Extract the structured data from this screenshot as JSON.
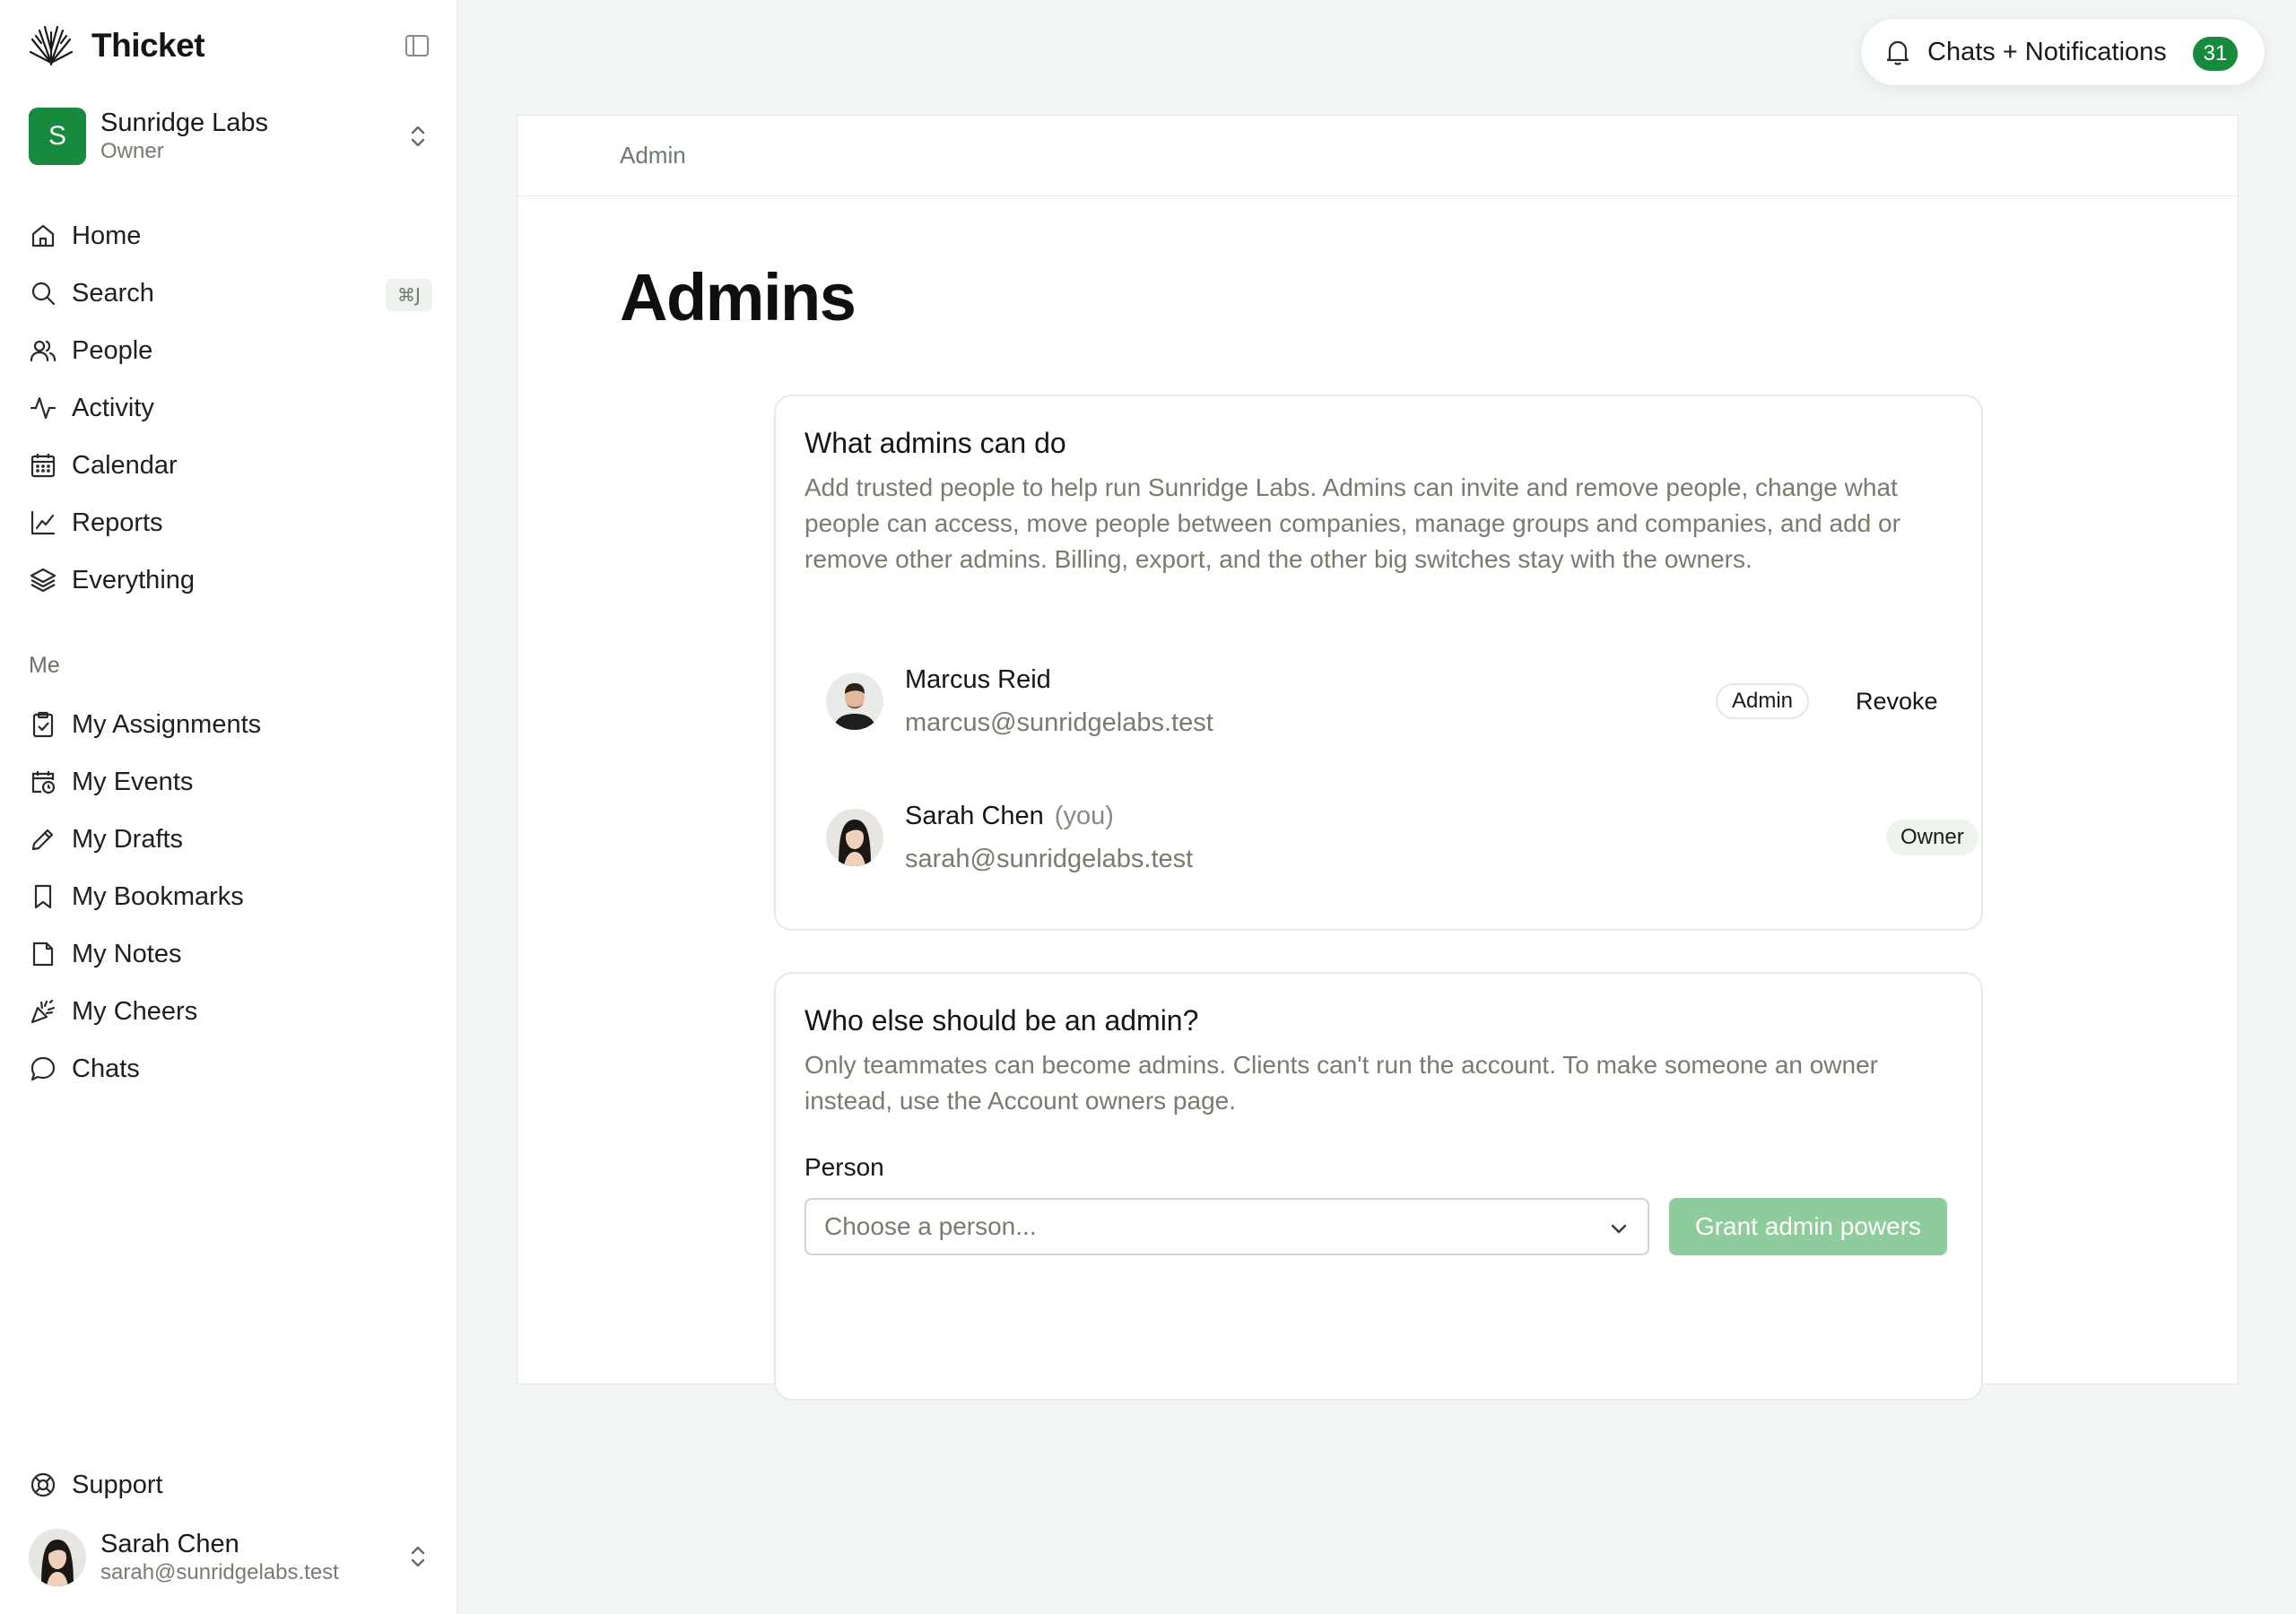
{
  "brand": {
    "name": "Thicket"
  },
  "org": {
    "initial": "S",
    "name": "Sunridge Labs",
    "role": "Owner"
  },
  "nav": {
    "main": [
      {
        "label": "Home",
        "icon": "home-icon"
      },
      {
        "label": "Search",
        "icon": "search-icon",
        "shortcut": "⌘J"
      },
      {
        "label": "People",
        "icon": "people-icon"
      },
      {
        "label": "Activity",
        "icon": "activity-icon"
      },
      {
        "label": "Calendar",
        "icon": "calendar-icon"
      },
      {
        "label": "Reports",
        "icon": "reports-icon"
      },
      {
        "label": "Everything",
        "icon": "layers-icon"
      }
    ],
    "me_section_label": "Me",
    "me": [
      {
        "label": "My Assignments",
        "icon": "clipboard-icon"
      },
      {
        "label": "My Events",
        "icon": "calendar-clock-icon"
      },
      {
        "label": "My Drafts",
        "icon": "pencil-icon"
      },
      {
        "label": "My Bookmarks",
        "icon": "bookmark-icon"
      },
      {
        "label": "My Notes",
        "icon": "note-icon"
      },
      {
        "label": "My Cheers",
        "icon": "party-popper-icon"
      },
      {
        "label": "Chats",
        "icon": "chat-bubble-icon"
      }
    ],
    "support": {
      "label": "Support",
      "icon": "life-buoy-icon"
    }
  },
  "current_user": {
    "name": "Sarah Chen",
    "email": "sarah@sunridgelabs.test"
  },
  "notifications": {
    "label": "Chats + Notifications",
    "count": "31"
  },
  "breadcrumb": "Admin",
  "page_title": "Admins",
  "admins_card": {
    "title": "What admins can do",
    "description": "Add trusted people to help run Sunridge Labs. Admins can invite and remove people, change what people can access, move people between companies, manage groups and companies, and add or remove other admins. Billing, export, and the other big switches stay with the owners.",
    "people": [
      {
        "name": "Marcus Reid",
        "you": "",
        "email": "marcus@sunridgelabs.test",
        "role": "Admin",
        "action": "Revoke"
      },
      {
        "name": "Sarah Chen",
        "you": "(you)",
        "email": "sarah@sunridgelabs.test",
        "role": "Owner",
        "action": ""
      }
    ]
  },
  "add_card": {
    "title": "Who else should be an admin?",
    "description": "Only teammates can become admins. Clients can't run the account. To make someone an owner instead, use the Account owners page.",
    "field_label": "Person",
    "select_placeholder": "Choose a person...",
    "button_label": "Grant admin powers"
  },
  "colors": {
    "accent": "#178a3e",
    "accent_disabled": "#8fcc9d",
    "background": "#f2f6f2"
  }
}
